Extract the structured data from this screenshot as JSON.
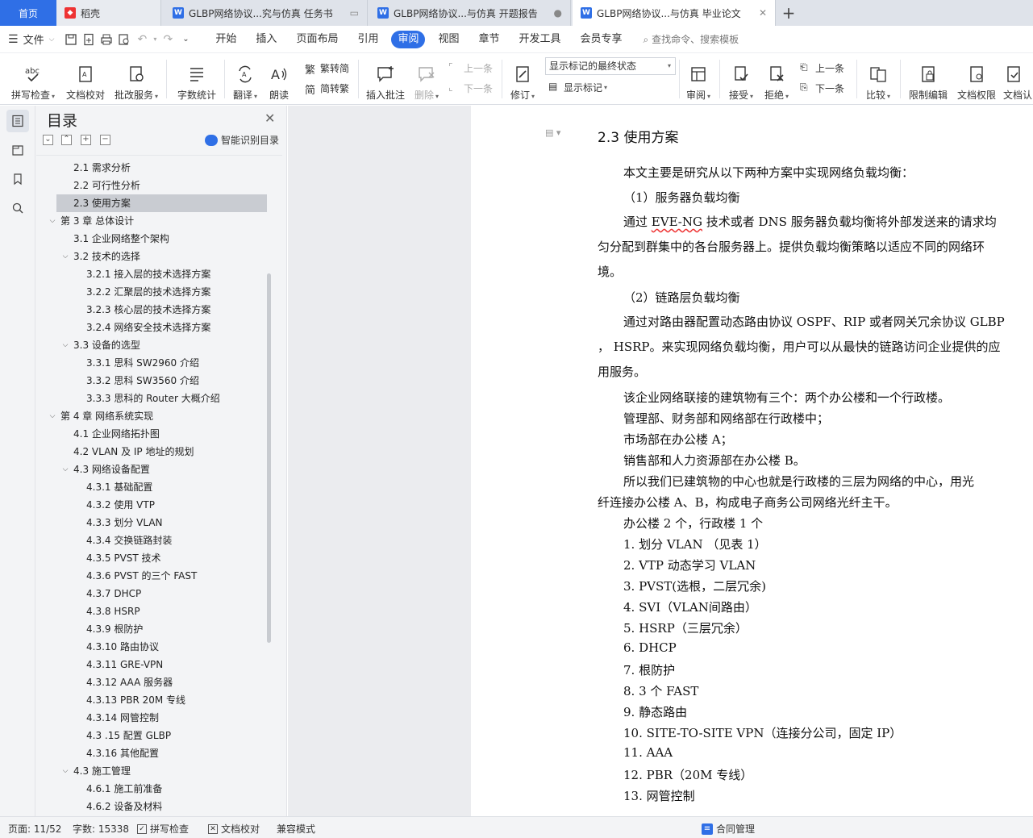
{
  "tabs": [
    {
      "label": "首页"
    },
    {
      "label": "稻壳"
    },
    {
      "label": "GLBP网络协议...究与仿真 任务书"
    },
    {
      "label": "GLBP网络协议...与仿真 开题报告"
    },
    {
      "label": "GLBP网络协议...与仿真 毕业论文"
    }
  ],
  "menu": {
    "file": "文件",
    "items": [
      "开始",
      "插入",
      "页面布局",
      "引用",
      "审阅",
      "视图",
      "章节",
      "开发工具",
      "会员专享"
    ],
    "active": "审阅",
    "search": "查找命令、搜索模板"
  },
  "ribbon": {
    "spell_check": "拼写检查",
    "doc_proof": "文档校对",
    "batch_service": "批改服务",
    "word_count": "字数统计",
    "translate": "翻译",
    "read_aloud": "朗读",
    "trad_simp": "繁转简",
    "simp_trad": "简转繁",
    "insert_comment": "插入批注",
    "delete": "删除",
    "prev_comment": "上一条",
    "next_comment": "下一条",
    "track_changes": "修订",
    "markup_state": "显示标记的最终状态",
    "show_markup": "显示标记",
    "review": "审阅",
    "accept": "接受",
    "reject": "拒绝",
    "prev_change": "上一条",
    "next_change": "下一条",
    "compare": "比较",
    "restrict_edit": "限制编辑",
    "doc_permission": "文档权限",
    "doc_auth": "文档认"
  },
  "toc": {
    "title": "目录",
    "smart": "智能识别目录",
    "items": [
      {
        "text": "2.1 需求分析",
        "level": 2
      },
      {
        "text": "2.2 可行性分析",
        "level": 2
      },
      {
        "text": "2.3 使用方案",
        "level": 2,
        "selected": true
      },
      {
        "text": "第 3 章  总体设计",
        "level": 1,
        "expanded": true
      },
      {
        "text": "3.1 企业网络整个架构",
        "level": 2
      },
      {
        "text": "3.2 技术的选择",
        "level": 2,
        "expanded": true
      },
      {
        "text": "3.2.1  接入层的技术选择方案",
        "level": 3
      },
      {
        "text": "3.2.2  汇聚层的技术选择方案",
        "level": 3
      },
      {
        "text": "3.2.3  核心层的技术选择方案",
        "level": 3
      },
      {
        "text": "3.2.4 网络安全技术选择方案",
        "level": 3
      },
      {
        "text": "3.3 设备的选型",
        "level": 2,
        "expanded": true
      },
      {
        "text": "3.3.1  思科 SW2960 介绍",
        "level": 3
      },
      {
        "text": "3.3.2  思科 SW3560 介绍",
        "level": 3
      },
      {
        "text": "3.3.3  思科的 Router 大概介绍",
        "level": 3
      },
      {
        "text": "第 4 章  网络系统实现",
        "level": 1,
        "expanded": true
      },
      {
        "text": "4.1  企业网络拓扑图",
        "level": 2
      },
      {
        "text": "4.2 VLAN 及 IP 地址的规划",
        "level": 2
      },
      {
        "text": "4.3 网络设备配置",
        "level": 2,
        "expanded": true
      },
      {
        "text": "4.3.1  基础配置",
        "level": 3
      },
      {
        "text": "4.3.2  使用 VTP",
        "level": 3
      },
      {
        "text": "4.3.3  划分 VLAN",
        "level": 3
      },
      {
        "text": "4.3.4  交换链路封装",
        "level": 3
      },
      {
        "text": "4.3.5 PVST 技术",
        "level": 3
      },
      {
        "text": "4.3.6 PVST 的三个 FAST",
        "level": 3
      },
      {
        "text": "4.3.7 DHCP",
        "level": 3
      },
      {
        "text": "4.3.8 HSRP",
        "level": 3
      },
      {
        "text": "4.3.9  根防护",
        "level": 3
      },
      {
        "text": "4.3.10  路由协议",
        "level": 3
      },
      {
        "text": "4.3.11 GRE-VPN",
        "level": 3
      },
      {
        "text": "4.3.12 AAA 服务器",
        "level": 3
      },
      {
        "text": "4.3.13 PBR 20M 专线",
        "level": 3
      },
      {
        "text": "4.3.14  网管控制",
        "level": 3
      },
      {
        "text": "4.3 .15 配置 GLBP",
        "level": 3
      },
      {
        "text": "4.3.16 其他配置",
        "level": 3
      },
      {
        "text": "4.3  施工管理",
        "level": 2,
        "expanded": true
      },
      {
        "text": "4.6.1  施工前准备",
        "level": 3
      },
      {
        "text": "4.6.2  设备及材料",
        "level": 3
      }
    ]
  },
  "document": {
    "heading": "2.3 使用方案",
    "intro": "本文主要是研究从以下两种方案中实现网络负载均衡：",
    "opt1": "（1）服务器负载均衡",
    "para1_pre": "通过 ",
    "para1_err": "EVE-NG",
    "para1_post": " 技术或者 DNS 服务器负载均衡将外部发送来的请求均匀分配到群集中的各台服务器上。提供负载均衡策略以适应不同的网络环境。",
    "opt2": "（2）链路层负载均衡",
    "para2": "通过对路由器配置动态路由协议 OSPF、RIP 或者网关冗余协议 GLBP ， HSRP。来实现网络负载均衡，用户可以从最快的链路访问企业提供的应用服务。",
    "b1": "该企业网络联接的建筑物有三个：两个办公楼和一个行政楼。",
    "b2": "管理部、财务部和网络部在行政楼中；",
    "b3": "市场部在办公楼 A；",
    "b4": "销售部和人力资源部在办公楼 B。",
    "b5": "所以我们已建筑物的中心也就是行政楼的三层为网络的中心，用光",
    "b6": "纤连接办公楼 A、B，构成电子商务公司网络光纤主干。",
    "b7": "办公楼 2 个，行政楼 1 个",
    "list": [
      "1. 划分 VLAN （见表 1）",
      "2. VTP 动态学习 VLAN",
      "3. PVST(选根，二层冗余)",
      "4. SVI（VLAN间路由）",
      "5. HSRP（三层冗余）",
      "6. DHCP",
      "7. 根防护",
      "8. 3 个 FAST",
      "9. 静态路由",
      "10. SITE-TO-SITE VPN（连接分公司，固定 IP）",
      "11. AAA",
      "12. PBR（20M 专线）",
      "13. 网管控制"
    ]
  },
  "status": {
    "page": "页面: 11/52",
    "words": "字数: 15338",
    "spell": "拼写检查",
    "proof": "文档校对",
    "compat": "兼容模式",
    "contract": "合同管理"
  },
  "colors": {
    "accent": "#2f6fe6",
    "tabbar": "#dfe3ea",
    "panel": "#f3f4f6",
    "canvas": "#ebecef"
  }
}
